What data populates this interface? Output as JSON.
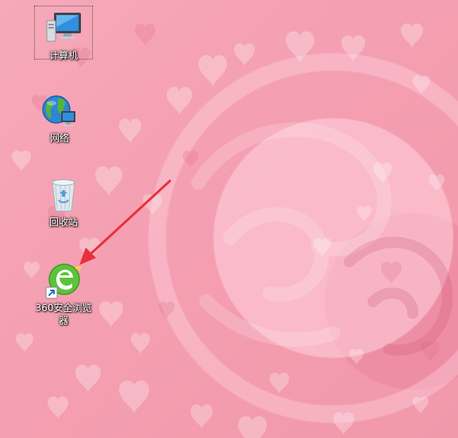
{
  "desktop": {
    "icons": [
      {
        "label": "计算机",
        "icon": "computer-icon",
        "selected": true
      },
      {
        "label": "网络",
        "icon": "network-globe-icon",
        "selected": false
      },
      {
        "label": "回收站",
        "icon": "recycle-bin-icon",
        "selected": false
      },
      {
        "label": "360安全浏览器",
        "icon": "360-browser-icon",
        "selected": false,
        "shortcut": true
      }
    ],
    "annotation": {
      "type": "arrow",
      "color": "#e8303a",
      "points_to": "360-browser-icon"
    }
  },
  "theme": {
    "wallpaper_base": "#f4a0b2",
    "wallpaper_light": "#ffd6e0",
    "label_color": "#ffffff",
    "browser_green": "#5cc33a"
  }
}
